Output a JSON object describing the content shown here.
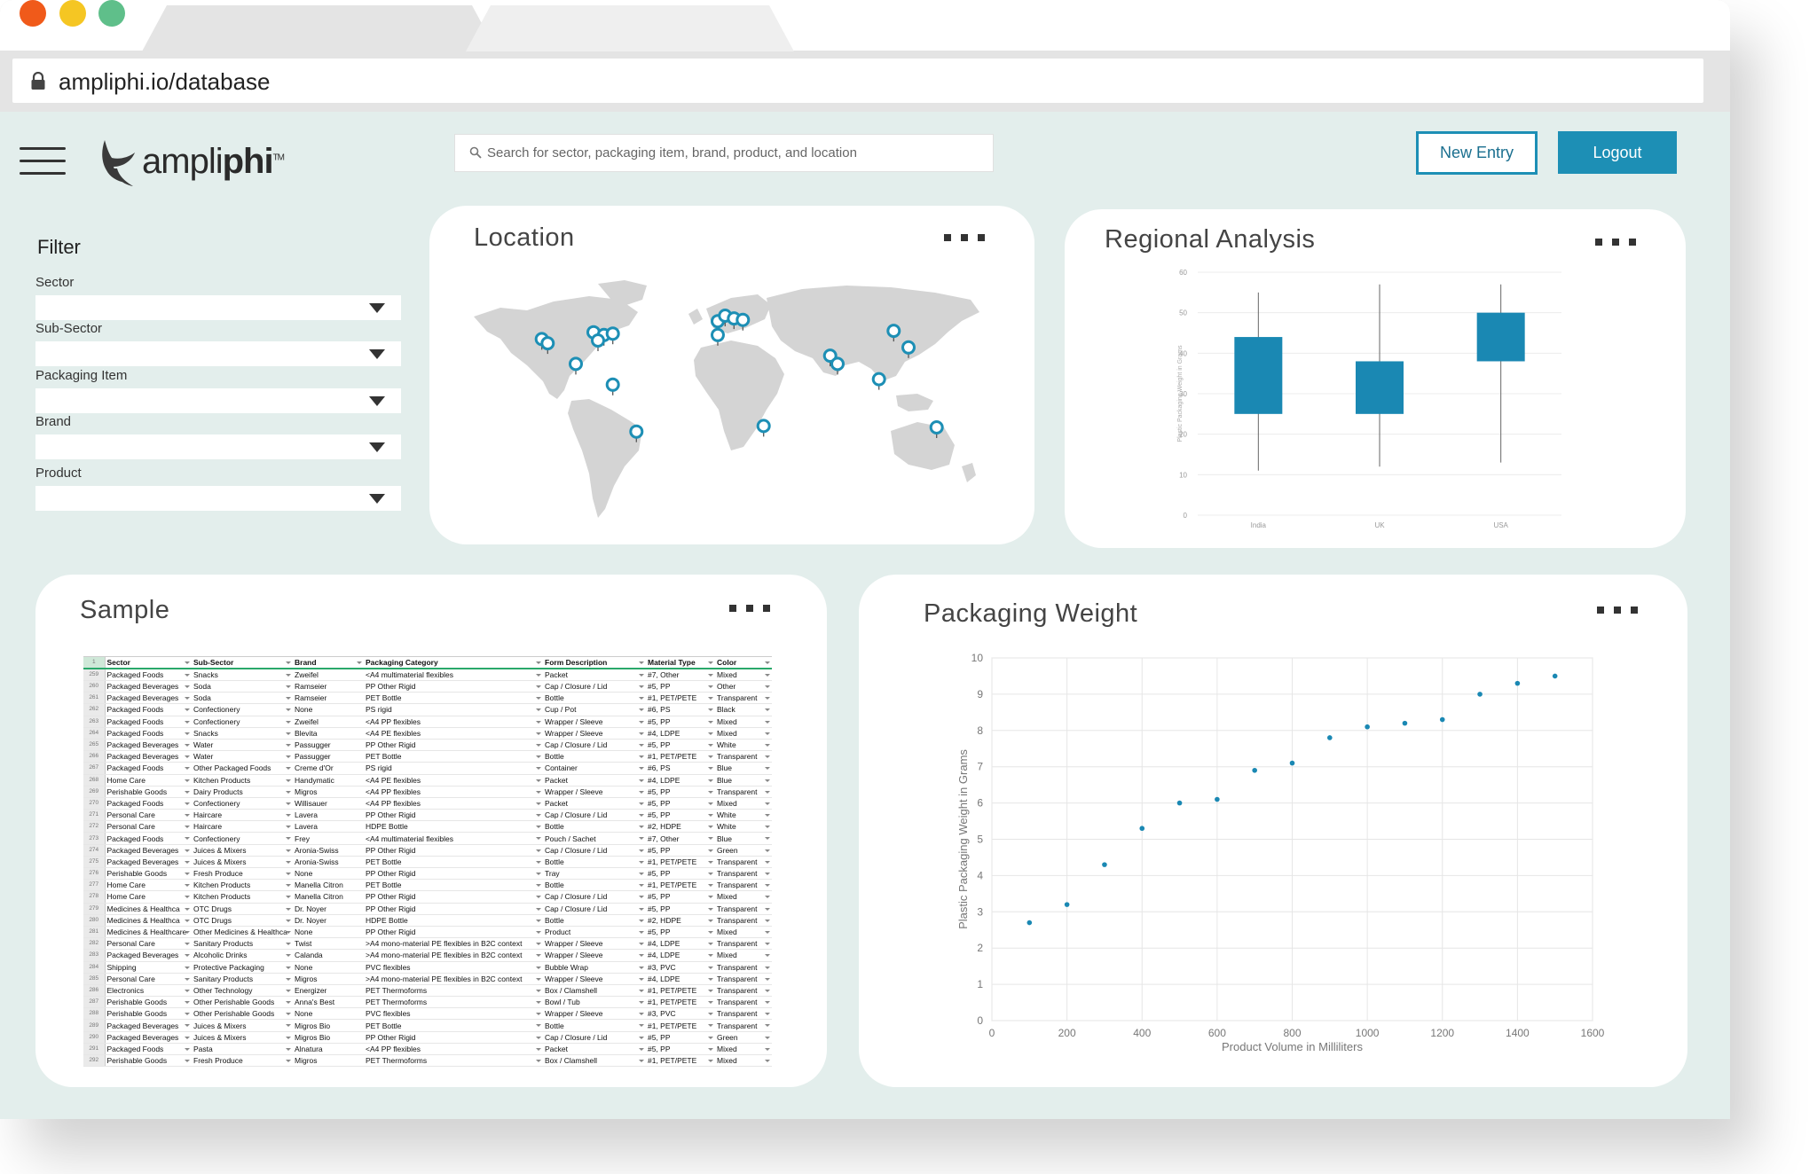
{
  "browser": {
    "url": "ampliphi.io/database"
  },
  "header": {
    "logo_text_light": "ampli",
    "logo_text_bold": "phi",
    "logo_tm": "TM",
    "search_placeholder": "Search for sector, packaging item, brand, product, and location",
    "new_entry_label": "New Entry",
    "logout_label": "Logout"
  },
  "filter": {
    "title": "Filter",
    "fields": [
      {
        "label": "Sector",
        "value": ""
      },
      {
        "label": "Sub-Sector",
        "value": ""
      },
      {
        "label": "Packaging Item",
        "value": ""
      },
      {
        "label": "Brand",
        "value": ""
      },
      {
        "label": "Product",
        "value": ""
      }
    ]
  },
  "cards": {
    "location_title": "Location",
    "regional_title": "Regional Analysis",
    "sample_title": "Sample",
    "weight_title": "Packaging Weight"
  },
  "colors": {
    "accent": "#1d8fb5",
    "background": "#e3eeec",
    "map_land": "#d4d4d4"
  },
  "chart_data": [
    {
      "type": "box",
      "title": "Regional Analysis",
      "ylabel": "Plastic Packaging Weight in Grams",
      "categories": [
        "India",
        "UK",
        "USA"
      ],
      "ylim": [
        0,
        60
      ],
      "yticks": [
        0,
        10,
        20,
        30,
        40,
        50,
        60
      ],
      "boxes": [
        {
          "category": "India",
          "min": 11,
          "q1": 25,
          "q3": 44,
          "max": 55
        },
        {
          "category": "UK",
          "min": 12,
          "q1": 25,
          "q3": 38,
          "max": 57
        },
        {
          "category": "USA",
          "min": 13,
          "q1": 38,
          "q3": 50,
          "max": 57
        }
      ],
      "color": "#1a88b3",
      "grid": "horizontal"
    },
    {
      "type": "scatter",
      "title": "Packaging Weight",
      "xlabel": "Product Volume in Milliliters",
      "ylabel": "Plastic Packaging Weight in Grams",
      "xlim": [
        0,
        1600
      ],
      "ylim": [
        0,
        10
      ],
      "xticks": [
        0,
        200,
        400,
        600,
        800,
        1000,
        1200,
        1400,
        1600
      ],
      "yticks": [
        0,
        1,
        2,
        3,
        4,
        5,
        6,
        7,
        8,
        9,
        10
      ],
      "points": [
        [
          100,
          2.7
        ],
        [
          200,
          3.2
        ],
        [
          300,
          4.3
        ],
        [
          400,
          5.3
        ],
        [
          500,
          6.0
        ],
        [
          600,
          6.1
        ],
        [
          700,
          6.9
        ],
        [
          800,
          7.1
        ],
        [
          900,
          7.8
        ],
        [
          1000,
          8.1
        ],
        [
          1100,
          8.2
        ],
        [
          1200,
          8.3
        ],
        [
          1300,
          9.0
        ],
        [
          1400,
          9.3
        ],
        [
          1500,
          9.5
        ]
      ],
      "color": "#1a88b3",
      "grid": "both"
    }
  ],
  "map_pins": [
    {
      "lon": -122,
      "lat": 37
    },
    {
      "lon": -118,
      "lat": 34
    },
    {
      "lon": -87,
      "lat": 42
    },
    {
      "lon": -80,
      "lat": 40
    },
    {
      "lon": -74,
      "lat": 41
    },
    {
      "lon": -84,
      "lat": 36
    },
    {
      "lon": -99,
      "lat": 19
    },
    {
      "lon": -74,
      "lat": 4
    },
    {
      "lon": -58,
      "lat": -30
    },
    {
      "lon": -3,
      "lat": 50
    },
    {
      "lon": 2,
      "lat": 54
    },
    {
      "lon": 8,
      "lat": 52
    },
    {
      "lon": 14,
      "lat": 51
    },
    {
      "lon": -3,
      "lat": 40
    },
    {
      "lon": 28,
      "lat": -26
    },
    {
      "lon": 73,
      "lat": 25
    },
    {
      "lon": 78,
      "lat": 19
    },
    {
      "lon": 116,
      "lat": 43
    },
    {
      "lon": 126,
      "lat": 31
    },
    {
      "lon": 106,
      "lat": 8
    },
    {
      "lon": 145,
      "lat": -27
    }
  ],
  "sample": {
    "headers": [
      "Sector",
      "Sub-Sector",
      "Brand",
      "Packaging Category",
      "Form Description",
      "Material Type",
      "Color"
    ],
    "rows": [
      [
        "259",
        "Packaged Foods",
        "Snacks",
        "Zweifel",
        "<A4 multimaterial flexibles",
        "Packet",
        "#7, Other",
        "Mixed"
      ],
      [
        "260",
        "Packaged Beverages",
        "Soda",
        "Ramseier",
        "PP Other Rigid",
        "Cap / Closure / Lid",
        "#5, PP",
        "Other"
      ],
      [
        "261",
        "Packaged Beverages",
        "Soda",
        "Ramseier",
        "PET Bottle",
        "Bottle",
        "#1, PET/PETE",
        "Transparent"
      ],
      [
        "262",
        "Packaged Foods",
        "Confectionery",
        "None",
        "PS rigid",
        "Cup / Pot",
        "#6, PS",
        "Black"
      ],
      [
        "263",
        "Packaged Foods",
        "Confectionery",
        "Zweifel",
        "<A4 PP flexibles",
        "Wrapper / Sleeve",
        "#5, PP",
        "Mixed"
      ],
      [
        "264",
        "Packaged Foods",
        "Snacks",
        "Blevita",
        "<A4 PE flexibles",
        "Wrapper / Sleeve",
        "#4, LDPE",
        "Mixed"
      ],
      [
        "265",
        "Packaged Beverages",
        "Water",
        "Passugger",
        "PP Other Rigid",
        "Cap / Closure / Lid",
        "#5, PP",
        "White"
      ],
      [
        "266",
        "Packaged Beverages",
        "Water",
        "Passugger",
        "PET Bottle",
        "Bottle",
        "#1, PET/PETE",
        "Transparent"
      ],
      [
        "267",
        "Packaged Foods",
        "Other Packaged Foods",
        "Creme d'Or",
        "PS rigid",
        "Container",
        "#6, PS",
        "Blue"
      ],
      [
        "268",
        "Home Care",
        "Kitchen Products",
        "Handymatic",
        "<A4 PE flexibles",
        "Packet",
        "#4, LDPE",
        "Blue"
      ],
      [
        "269",
        "Perishable Goods",
        "Dairy Products",
        "Migros",
        "<A4 PP flexibles",
        "Wrapper / Sleeve",
        "#5, PP",
        "Transparent"
      ],
      [
        "270",
        "Packaged Foods",
        "Confectionery",
        "Willisauer",
        "<A4 PP flexibles",
        "Packet",
        "#5, PP",
        "Mixed"
      ],
      [
        "271",
        "Personal Care",
        "Haircare",
        "Lavera",
        "PP Other Rigid",
        "Cap / Closure / Lid",
        "#5, PP",
        "White"
      ],
      [
        "272",
        "Personal Care",
        "Haircare",
        "Lavera",
        "HDPE Bottle",
        "Bottle",
        "#2, HDPE",
        "White"
      ],
      [
        "273",
        "Packaged Foods",
        "Confectionery",
        "Frey",
        "<A4 multimaterial flexibles",
        "Pouch / Sachet",
        "#7, Other",
        "Blue"
      ],
      [
        "274",
        "Packaged Beverages",
        "Juices & Mixers",
        "Aronia-Swiss",
        "PP Other Rigid",
        "Cap / Closure / Lid",
        "#5, PP",
        "Green"
      ],
      [
        "275",
        "Packaged Beverages",
        "Juices & Mixers",
        "Aronia-Swiss",
        "PET Bottle",
        "Bottle",
        "#1, PET/PETE",
        "Transparent"
      ],
      [
        "276",
        "Perishable Goods",
        "Fresh Produce",
        "None",
        "PP Other Rigid",
        "Tray",
        "#5, PP",
        "Transparent"
      ],
      [
        "277",
        "Home Care",
        "Kitchen Products",
        "Manella Citron",
        "PET Bottle",
        "Bottle",
        "#1, PET/PETE",
        "Transparent"
      ],
      [
        "278",
        "Home Care",
        "Kitchen Products",
        "Manella Citron",
        "PP Other Rigid",
        "Cap / Closure / Lid",
        "#5, PP",
        "Mixed"
      ],
      [
        "279",
        "Medicines & Healthca",
        "OTC Drugs",
        "Dr. Noyer",
        "PP Other Rigid",
        "Cap / Closure / Lid",
        "#5, PP",
        "Transparent"
      ],
      [
        "280",
        "Medicines & Healthca",
        "OTC Drugs",
        "Dr. Noyer",
        "HDPE Bottle",
        "Bottle",
        "#2, HDPE",
        "Transparent"
      ],
      [
        "281",
        "Medicines & Healthcare",
        "Other Medicines & Healthca",
        "None",
        "PP Other Rigid",
        "Product",
        "#5, PP",
        "Mixed"
      ],
      [
        "282",
        "Personal Care",
        "Sanitary Products",
        "Twist",
        ">A4 mono-material PE flexibles in B2C context",
        "Wrapper / Sleeve",
        "#4, LDPE",
        "Transparent"
      ],
      [
        "283",
        "Packaged Beverages",
        "Alcoholic Drinks",
        "Calanda",
        ">A4 mono-material PE flexibles in B2C context",
        "Wrapper / Sleeve",
        "#4, LDPE",
        "Mixed"
      ],
      [
        "284",
        "Shipping",
        "Protective Packaging",
        "None",
        "PVC flexibles",
        "Bubble Wrap",
        "#3, PVC",
        "Transparent"
      ],
      [
        "285",
        "Personal Care",
        "Sanitary Products",
        "Migros",
        ">A4 mono-material PE flexibles in B2C context",
        "Wrapper / Sleeve",
        "#4, LDPE",
        "Transparent"
      ],
      [
        "286",
        "Electronics",
        "Other Technology",
        "Energizer",
        "PET Thermoforms",
        "Box / Clamshell",
        "#1, PET/PETE",
        "Transparent"
      ],
      [
        "287",
        "Perishable Goods",
        "Other Perishable Goods",
        "Anna's Best",
        "PET Thermoforms",
        "Bowl / Tub",
        "#1, PET/PETE",
        "Transparent"
      ],
      [
        "288",
        "Perishable Goods",
        "Other Perishable Goods",
        "None",
        "PVC flexibles",
        "Wrapper / Sleeve",
        "#3, PVC",
        "Transparent"
      ],
      [
        "289",
        "Packaged Beverages",
        "Juices & Mixers",
        "Migros Bio",
        "PET Bottle",
        "Bottle",
        "#1, PET/PETE",
        "Transparent"
      ],
      [
        "290",
        "Packaged Beverages",
        "Juices & Mixers",
        "Migros Bio",
        "PP Other Rigid",
        "Cap / Closure / Lid",
        "#5, PP",
        "Green"
      ],
      [
        "291",
        "Packaged Foods",
        "Pasta",
        "Alnatura",
        "<A4 PP flexibles",
        "Packet",
        "#5, PP",
        "Mixed"
      ],
      [
        "292",
        "Perishable Goods",
        "Fresh Produce",
        "Migros",
        "PET Thermoforms",
        "Box / Clamshell",
        "#1, PET/PETE",
        "Mixed"
      ]
    ]
  }
}
